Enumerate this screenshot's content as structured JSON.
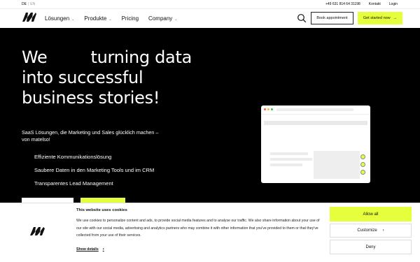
{
  "header": {
    "lang_active": "DE",
    "lang_inactive": "EN",
    "phone": "+49 631 814 64 31198",
    "contact": "Kontakt",
    "login": "Login",
    "nav": [
      {
        "label": "Lösungen",
        "has_dropdown": true
      },
      {
        "label": "Produkte",
        "has_dropdown": true
      },
      {
        "label": "Pricing",
        "has_dropdown": false
      },
      {
        "label": "Company",
        "has_dropdown": true
      }
    ],
    "book_label": "Book appointment",
    "start_label": "Get started now",
    "start_arrow": "→"
  },
  "hero": {
    "line1_a": "We",
    "line1_b": "turning data",
    "line2": "into successful",
    "line3": "business stories!",
    "sub": "SaaS Lösungen, die Marketing und Sales glücklich machen – von matelso!",
    "features": [
      "Effiziente Kommunikationslösung",
      "Saubere Daten in den Marketing Tools und im CRM",
      "Transparentes Lead Management"
    ]
  },
  "cookie": {
    "title": "This website uses cookies",
    "text": "We use cookies to personalize content and ads, to provide social media features and to analyse our traffic. We also share information about your use of our site with our social media, advertising and analytics partners who may combine it with other information that you've provided to them or that they've collected from your use of their services.",
    "details": "Show details",
    "allow": "Allow all",
    "customize": "Customize",
    "deny": "Deny"
  },
  "colors": {
    "accent": "#e6ff3c",
    "hero_bg": "#000000"
  }
}
